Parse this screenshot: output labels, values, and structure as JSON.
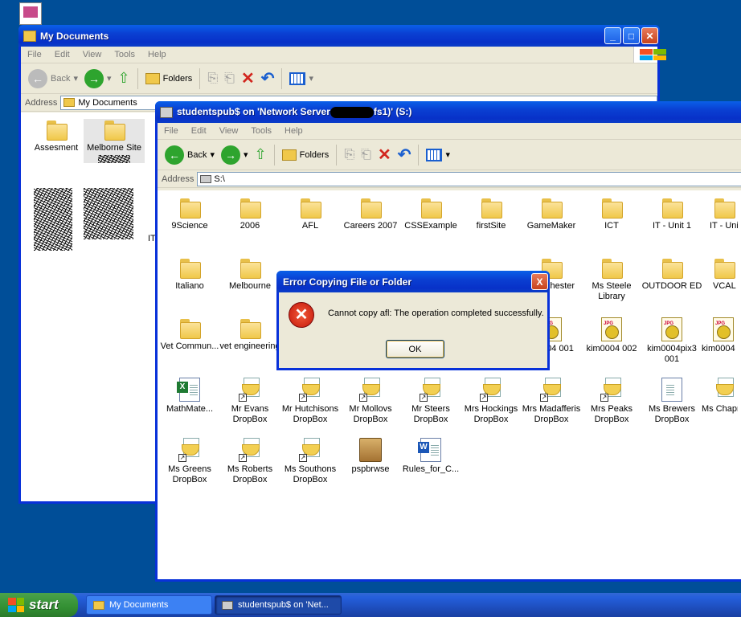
{
  "colors": {
    "desktop": "#004e98",
    "title_blue": "#0a3fd2",
    "dialog_error": "#c4170a"
  },
  "win1": {
    "title": "My Documents",
    "menu": [
      "File",
      "Edit",
      "View",
      "Tools",
      "Help"
    ],
    "toolbar": {
      "back": "Back",
      "folders": "Folders"
    },
    "address_label": "Address",
    "address_value": "My Documents",
    "items": [
      {
        "label": "Assesment",
        "icon": "folder-icon"
      },
      {
        "label": "Melborne Site",
        "icon": "folder-icon"
      }
    ],
    "partial_label": "IT"
  },
  "win2": {
    "title_part1": "studentspub$ on 'Network Server",
    "title_part2": "fs1)' (S:)",
    "menu": [
      "File",
      "Edit",
      "View",
      "Tools",
      "Help"
    ],
    "toolbar": {
      "back": "Back",
      "folders": "Folders"
    },
    "address_label": "Address",
    "address_value": "S:\\",
    "items": [
      {
        "label": "9Science",
        "icon": "folder"
      },
      {
        "label": "2006",
        "icon": "folder"
      },
      {
        "label": "AFL",
        "icon": "folder"
      },
      {
        "label": "Careers 2007",
        "icon": "folder"
      },
      {
        "label": "CSSExample",
        "icon": "folder"
      },
      {
        "label": "firstSite",
        "icon": "folder"
      },
      {
        "label": "GameMaker",
        "icon": "folder"
      },
      {
        "label": "ICT",
        "icon": "folder"
      },
      {
        "label": "IT - Unit 1",
        "icon": "folder"
      },
      {
        "label": "IT - Uni",
        "icon": "folder"
      },
      {
        "label": "Italiano",
        "icon": "folder"
      },
      {
        "label": "Melbourne",
        "icon": "folder"
      },
      {
        "label": "chester",
        "icon": "folder"
      },
      {
        "label": "Ms Steele Library",
        "icon": "folder"
      },
      {
        "label": "OUTDOOR ED",
        "icon": "folder"
      },
      {
        "label": "VCAL",
        "icon": "folder"
      },
      {
        "label": "Vet Commun...",
        "icon": "folder"
      },
      {
        "label": "vet engineering",
        "icon": "folder"
      },
      {
        "label": "04 001",
        "icon": "jpg"
      },
      {
        "label": "kim0004 002",
        "icon": "jpg"
      },
      {
        "label": "kim0004pix3 001",
        "icon": "jpg"
      },
      {
        "label": "kim0004",
        "icon": "jpg"
      },
      {
        "label": "MathMate...",
        "icon": "excel"
      },
      {
        "label": "Mr Evans DropBox",
        "icon": "dropbox"
      },
      {
        "label": "Mr Hutchisons DropBox",
        "icon": "dropbox"
      },
      {
        "label": "Mr Mollovs DropBox",
        "icon": "dropbox"
      },
      {
        "label": "Mr Steers DropBox",
        "icon": "dropbox"
      },
      {
        "label": "Mrs Hockings DropBox",
        "icon": "dropbox"
      },
      {
        "label": "Mrs Madafferis DropBox",
        "icon": "dropbox"
      },
      {
        "label": "Mrs Peaks DropBox",
        "icon": "dropbox"
      },
      {
        "label": "Ms Brewers DropBox",
        "icon": "dropbox-doc"
      },
      {
        "label": "Ms Chapr DropB",
        "icon": "dropbox"
      },
      {
        "label": "Ms Greens DropBox",
        "icon": "dropbox"
      },
      {
        "label": "Ms Roberts DropBox",
        "icon": "dropbox"
      },
      {
        "label": "Ms Southons DropBox",
        "icon": "dropbox"
      },
      {
        "label": "pspbrwse",
        "icon": "package"
      },
      {
        "label": "Rules_for_C...",
        "icon": "word"
      }
    ]
  },
  "dialog": {
    "title": "Error Copying File or Folder",
    "message": "Cannot copy afl: The operation completed successfully.",
    "ok": "OK",
    "close": "X"
  },
  "taskbar": {
    "start": "start",
    "tasks": [
      "My Documents",
      "studentspub$ on 'Net..."
    ]
  }
}
